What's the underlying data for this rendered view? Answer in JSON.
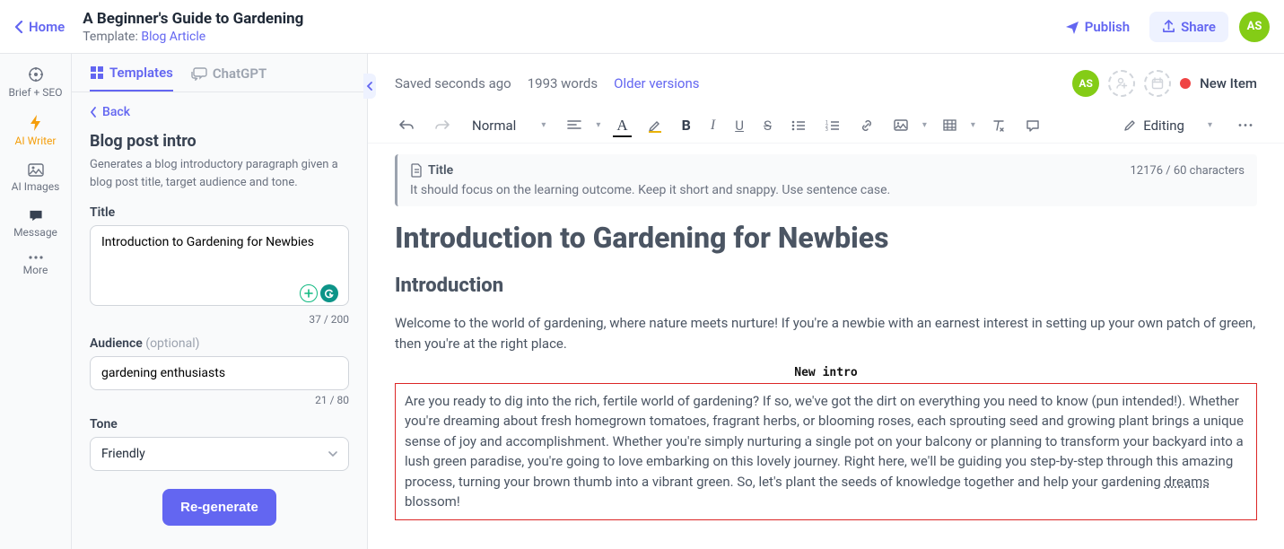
{
  "header": {
    "home": "Home",
    "doc_title": "A Beginner's Guide to Gardening",
    "template_label": "Template:",
    "template_name": "Blog Article",
    "publish": "Publish",
    "share": "Share",
    "avatar": "AS"
  },
  "rail": {
    "brief": "Brief + SEO",
    "writer": "AI Writer",
    "images": "AI Images",
    "message": "Message",
    "more": "More"
  },
  "sidebar": {
    "tabs": {
      "templates": "Templates",
      "chatgpt": "ChatGPT"
    },
    "back": "Back",
    "panel_title": "Blog post intro",
    "panel_desc": "Generates a blog introductory paragraph given a blog post title, target audience and tone.",
    "title_label": "Title",
    "title_value": "Introduction to Gardening for Newbies",
    "title_counter": "37 / 200",
    "audience_label": "Audience",
    "audience_optional": "(optional)",
    "audience_value": "gardening enthusiasts",
    "audience_counter": "21 / 80",
    "tone_label": "Tone",
    "tone_value": "Friendly",
    "regenerate": "Re-generate"
  },
  "status": {
    "saved": "Saved seconds ago",
    "words": "1993 words",
    "older": "Older versions",
    "avatar": "AS",
    "new_item": "New Item"
  },
  "toolbar": {
    "style": "Normal",
    "editing": "Editing"
  },
  "title_callout": {
    "label": "Title",
    "count": "12176 / 60 characters",
    "desc": "It should focus on the learning outcome. Keep it short and snappy. Use sentence case."
  },
  "content": {
    "h1": "Introduction to Gardening for Newbies",
    "h2": "Introduction",
    "para1": "Welcome to the world of gardening, where nature meets nurture! If you're a newbie with an earnest interest in setting up your own patch of green, then you're at the right place.",
    "new_intro_label": "New intro",
    "intro_box_a": "Are you ready to dig into the rich, fertile world of gardening? If so, we've got the dirt on everything you need to know (pun intended!). Whether you're dreaming about fresh homegrown tomatoes, fragrant herbs, or blooming roses, each sprouting seed and growing plant brings a unique sense of joy and accomplishment. Whether you're simply nurturing a single pot on your balcony or planning to transform your backyard into a lush green paradise, you're going to love embarking on this lovely journey. Right here, we'll be guiding you step-by-step through this amazing process, turning your brown thumb into a vibrant green. So, let's plant the seeds of knowledge together and help your gardening ",
    "intro_box_dreams": "dreams",
    "intro_box_b": " blossom!"
  }
}
